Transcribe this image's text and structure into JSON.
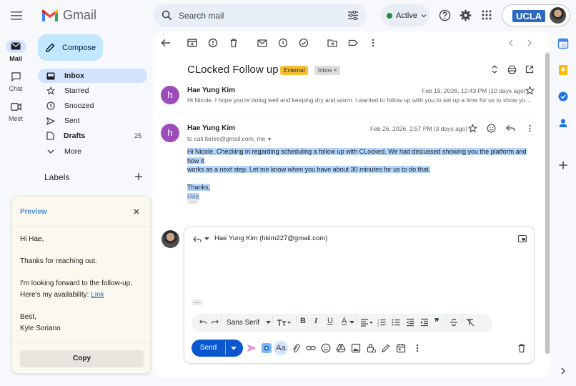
{
  "app": {
    "name": "Gmail",
    "search_placeholder": "Search mail",
    "status": "Active",
    "account_badge": "UCLA"
  },
  "rail": {
    "items": [
      {
        "label": "Mail",
        "icon": "mail-icon",
        "active": true
      },
      {
        "label": "Chat",
        "icon": "chat-icon"
      },
      {
        "label": "Meet",
        "icon": "meet-icon"
      }
    ]
  },
  "nav": {
    "compose": "Compose",
    "items": [
      {
        "label": "Inbox",
        "icon": "inbox-icon",
        "active": true
      },
      {
        "label": "Starred",
        "icon": "star-icon"
      },
      {
        "label": "Snoozed",
        "icon": "clock-icon"
      },
      {
        "label": "Sent",
        "icon": "send-icon"
      },
      {
        "label": "Drafts",
        "icon": "draft-icon",
        "count": "25"
      },
      {
        "label": "More",
        "icon": "chevron-down-icon"
      }
    ],
    "labels_heading": "Labels"
  },
  "preview": {
    "title": "Preview",
    "greeting": "Hi Hae,",
    "line1": "Thanks for reaching out.",
    "line2": "I'm looking forward to the follow-up.",
    "line3_prefix": "Here's my availability: ",
    "link": "Link",
    "closing": "Best,",
    "name": "Kyle Soriano",
    "copy_button": "Copy"
  },
  "thread": {
    "subject": "CLocked Follow up",
    "badges": {
      "external": "External",
      "inbox": "Inbox"
    },
    "messages": [
      {
        "avatar_letter": "h",
        "sender": "Hae Yung Kim",
        "date": "Feb 19, 2026, 12:43 PM (10 days ago)",
        "snippet": "Hi Nicole. I hope you're doing well and keeping dry and warm. I wanted to follow up with you to set up a time for us to show you the platform."
      },
      {
        "avatar_letter": "h",
        "sender": "Hae Yung Kim",
        "date": "Feb 26, 2026, 2:57 PM (3 days ago)",
        "to": "to cali.faries@gmail.com, me",
        "body_line1": "Hi Nicole.  Checking in regarding scheduling a follow up with CLocked. We had discussed showing you the platform and how it",
        "body_line2": "works as a next step.  Let me know when you have about 30 minutes for us to do that.",
        "body_thanks": "Thanks,",
        "body_sig": "Hae"
      }
    ]
  },
  "reply": {
    "recipient": "Hae Yung Kim (hkim227@gmail.com)",
    "font": "Sans Serif",
    "send_label": "Send"
  },
  "colors": {
    "accent": "#0b57d0",
    "compose_bg": "#c2e7ff",
    "nav_active": "#d3e3fd",
    "avatar_purple": "#9c4dba",
    "external_badge": "#f7c033",
    "active_green": "#1e8e3e",
    "highlight": "#b4d5fe"
  }
}
